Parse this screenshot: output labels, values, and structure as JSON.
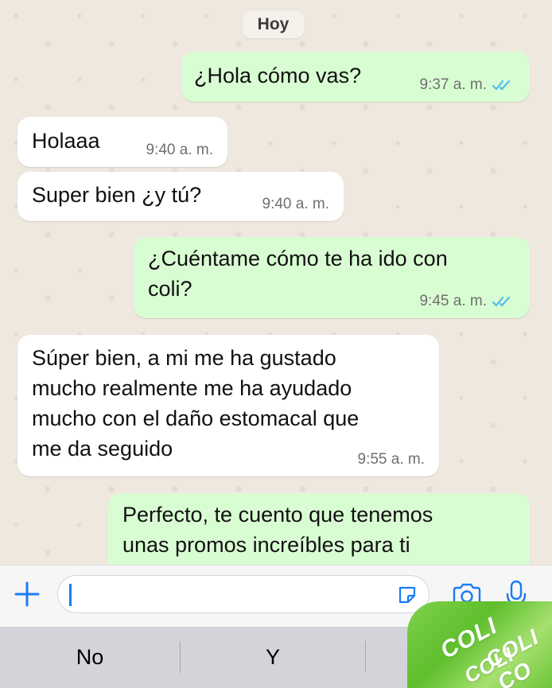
{
  "date_chip": "Hoy",
  "messages": [
    {
      "side": "out",
      "text": "¿Hola cómo vas?",
      "time": "9:37 a. m.",
      "read": true
    },
    {
      "side": "in",
      "text": "Holaaa",
      "time": "9:40 a. m."
    },
    {
      "side": "in",
      "text": "Super bien ¿y tú?",
      "time": "9:40 a. m."
    },
    {
      "side": "out",
      "text": "¿Cuéntame cómo te ha ido con\ncoli?",
      "time": "9:45 a. m.",
      "read": true
    },
    {
      "side": "in",
      "text": "Súper bien, a mi me ha gustado\nmucho realmente me ha ayudado\nmucho con el daño estomacal que\nme da seguido",
      "time": "9:55 a. m."
    },
    {
      "side": "out",
      "text": "Perfecto, te cuento que tenemos\nunas promos increíbles para ti",
      "time": ""
    }
  ],
  "input_bar": {
    "plus_icon": "plus-icon",
    "message_value": "",
    "sticker_icon": "sticker-icon",
    "camera_icon": "camera-icon",
    "mic_icon": "microphone-icon"
  },
  "keyboard_suggestions": [
    "No",
    "Y"
  ],
  "overlay": {
    "brand": "COLI",
    "brand_2": "COLI",
    "brand_3": "COLI CO"
  },
  "colors": {
    "outgoing": "#d9fdd3",
    "incoming": "#ffffff",
    "accent": "#1a7cf5",
    "read_ticks": "#53bdeb"
  }
}
